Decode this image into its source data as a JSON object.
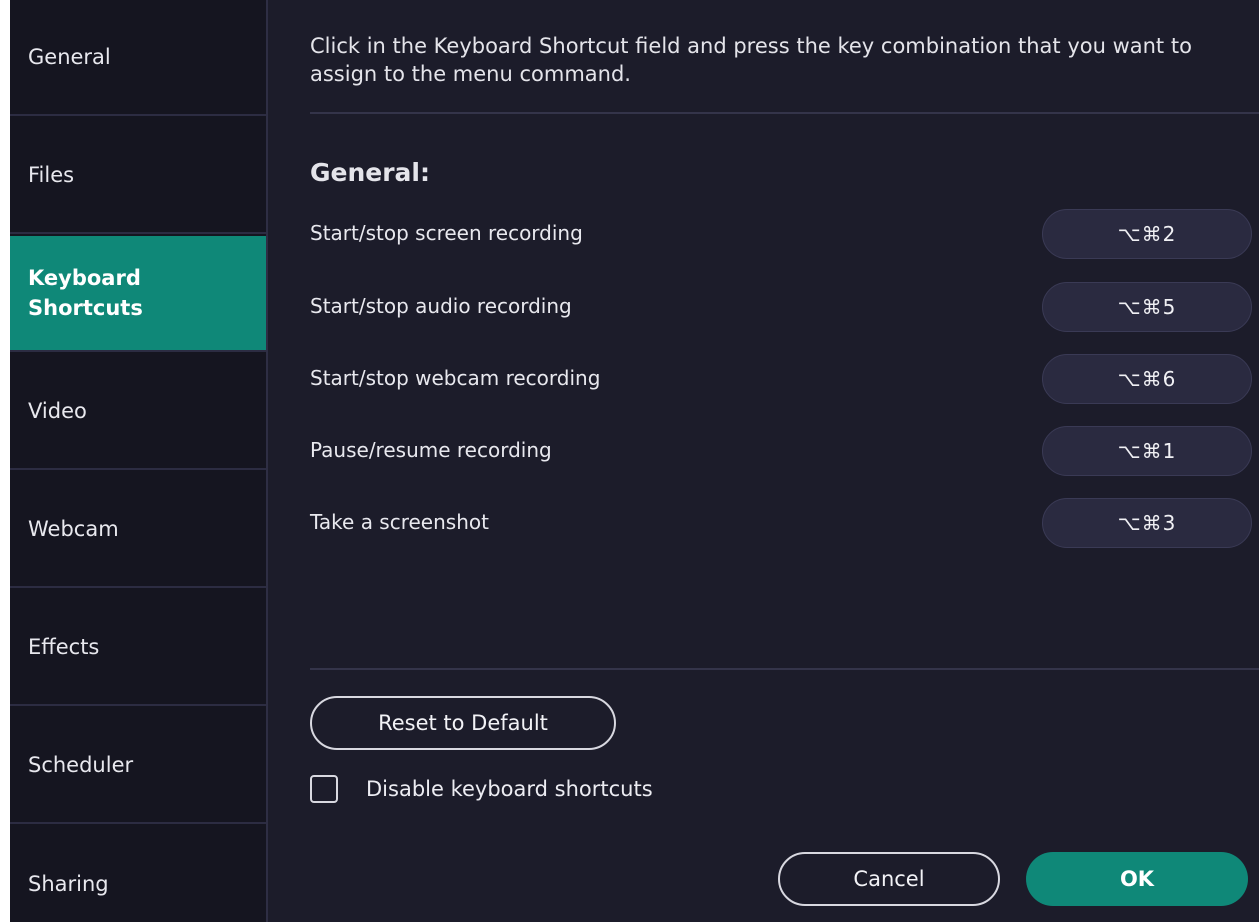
{
  "sidebar": {
    "items": [
      {
        "label": "General"
      },
      {
        "label": "Files"
      },
      {
        "label": "Keyboard\nShortcuts",
        "active": true
      },
      {
        "label": "Video"
      },
      {
        "label": "Webcam"
      },
      {
        "label": "Effects"
      },
      {
        "label": "Scheduler"
      },
      {
        "label": "Sharing"
      }
    ]
  },
  "main": {
    "instructions": "Click in the Keyboard Shortcut field and press the key combination that you want to assign to the menu command.",
    "section_title": "General:",
    "shortcuts": [
      {
        "label": "Start/stop screen recording",
        "keys": "⌥⌘2"
      },
      {
        "label": "Start/stop audio recording",
        "keys": "⌥⌘5"
      },
      {
        "label": "Start/stop webcam recording",
        "keys": "⌥⌘6"
      },
      {
        "label": "Pause/resume recording",
        "keys": "⌥⌘1"
      },
      {
        "label": "Take a screenshot",
        "keys": "⌥⌘3"
      }
    ],
    "reset_label": "Reset to Default",
    "disable_label": "Disable keyboard shortcuts",
    "disable_checked": false
  },
  "footer": {
    "cancel_label": "Cancel",
    "ok_label": "OK"
  },
  "colors": {
    "accent": "#0f8878",
    "background": "#1c1c2a",
    "sidebar": "#151520"
  }
}
